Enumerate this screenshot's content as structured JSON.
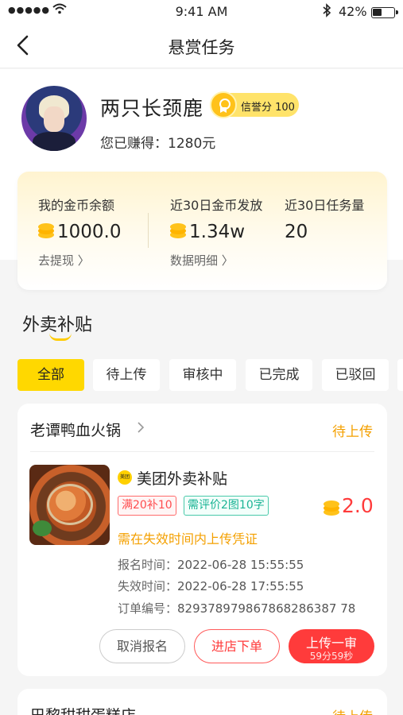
{
  "status_bar": {
    "signal": "●●●●●",
    "time": "9:41 AM",
    "battery": "42%"
  },
  "nav": {
    "title": "悬赏任务"
  },
  "user": {
    "name": "两只长颈鹿",
    "credit_label": "信誉分 100",
    "earned": "您已赚得：1280元"
  },
  "stats": {
    "balance": {
      "label": "我的金币余额",
      "value": "1000.0",
      "link": "去提现 〉"
    },
    "issued": {
      "label": "近30日金币发放",
      "value": "1.34w",
      "link": "数据明细 〉"
    },
    "tasks": {
      "label": "近30日任务量",
      "value": "20"
    }
  },
  "section": {
    "title": "外卖补贴"
  },
  "tabs": [
    "全部",
    "待上传",
    "审核中",
    "已完成",
    "已驳回"
  ],
  "orders": [
    {
      "shop": "老谭鸭血火锅",
      "status": "待上传",
      "platform_logo": "美团",
      "platform": "美团外卖补贴",
      "tag_discount": "满20补10",
      "tag_review": "需评价2图10字",
      "reward": "2.0",
      "hint": "需在失效时间内上传凭证",
      "signup_label": "报名时间：",
      "signup_time": "2022-06-28 15:55:55",
      "expire_label": "失效时间：",
      "expire_time": "2022-06-28 17:55:55",
      "order_label": "订单编号：",
      "order_no": "829378979867868286387 78",
      "btn_cancel": "取消报名",
      "btn_order": "进店下单",
      "btn_upload": "上传一审",
      "btn_upload_timer": "59分59秒"
    },
    {
      "shop": "巴黎甜甜蛋糕店",
      "status": "待上传"
    }
  ]
}
